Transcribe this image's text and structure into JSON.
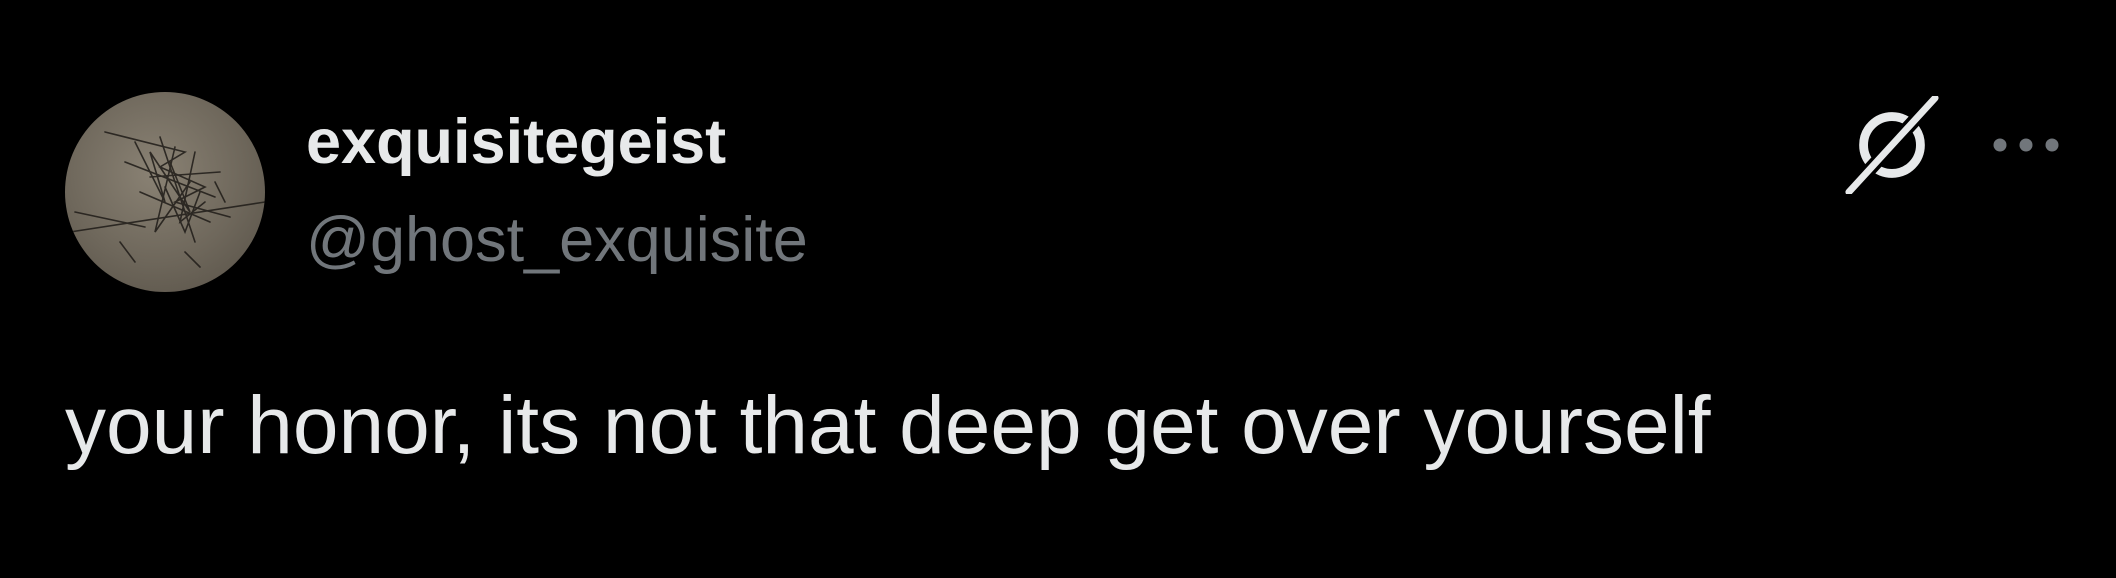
{
  "theme": {
    "background": "#000000",
    "primary_text": "#e7e9ea",
    "secondary_text": "#71767b"
  },
  "post": {
    "author": {
      "display_name": "exquisitegeist",
      "handle": "@ghost_exquisite",
      "avatar_icon": "sketch-drawing-avatar"
    },
    "text": "your honor, its not that deep get over yourself",
    "actions": {
      "grok_icon": "grok-icon",
      "more_icon": "more-options-icon"
    }
  }
}
